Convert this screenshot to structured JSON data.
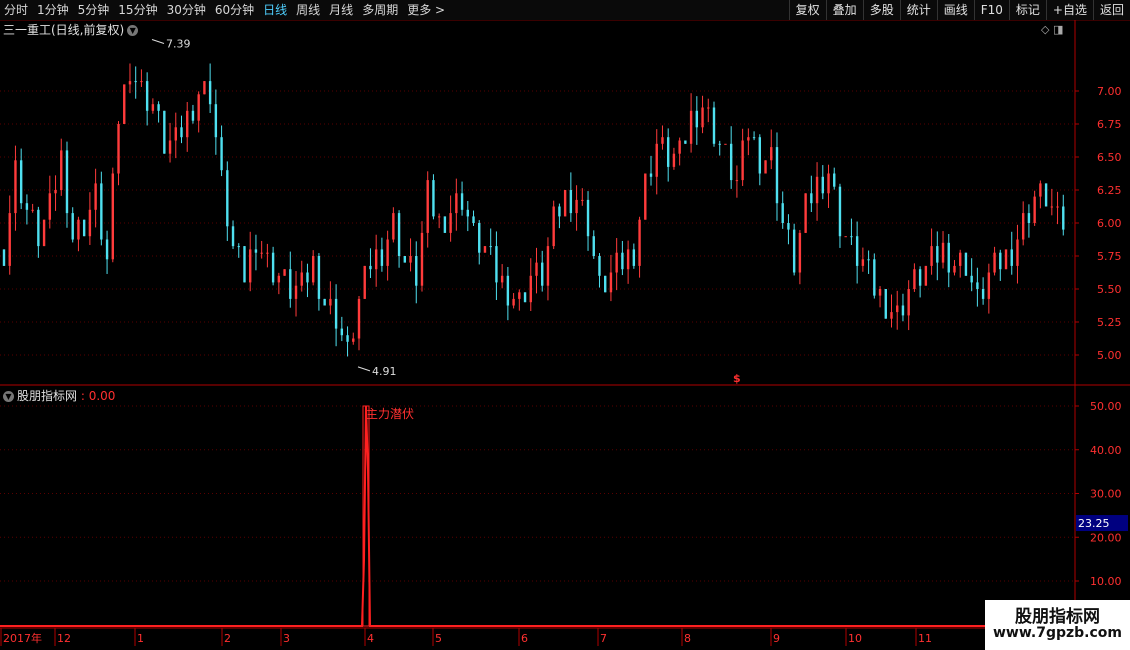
{
  "toolbar": {
    "periods": [
      "分时",
      "1分钟",
      "5分钟",
      "15分钟",
      "30分钟",
      "60分钟",
      "日线",
      "周线",
      "月线",
      "多周期",
      "更多 >"
    ],
    "active_period": "日线",
    "right_buttons": [
      "复权",
      "叠加",
      "多股",
      "统计",
      "画线",
      "F10",
      "标记",
      "+自选",
      "返回"
    ]
  },
  "main_chart": {
    "title": "三一重工(日线,前复权)",
    "icons": [
      "diamond-icon",
      "window-icon"
    ]
  },
  "indicator": {
    "name": "股朋指标网",
    "value_sep": " : ",
    "value": "0.00",
    "signal_label": "主力潜伏",
    "current_marker": "23.25"
  },
  "watermark": {
    "line1": "股朋指标网",
    "line2": "www.7gpzb.com"
  },
  "colors": {
    "up": "#ff3b3b",
    "down": "#4fe0f0",
    "axis": "#b00000",
    "grid": "#5a0000",
    "text_red": "#ff3030"
  },
  "chart_data": {
    "type": "candlestick",
    "price_axis": {
      "ticks": [
        "7.00",
        "6.75",
        "6.50",
        "6.25",
        "6.00",
        "5.75",
        "5.50",
        "5.25",
        "5.00"
      ]
    },
    "price_annotations": [
      {
        "label": "7.39",
        "value": 7.39
      },
      {
        "label": "4.91",
        "value": 4.91
      }
    ],
    "signal_mark": "$",
    "indicator_axis": {
      "ticks": [
        "50.00",
        "40.00",
        "30.00",
        "20.00",
        "10.00"
      ]
    },
    "time_axis": [
      "2017年",
      "12",
      "1",
      "2",
      "3",
      "4",
      "5",
      "6",
      "7",
      "8",
      "9",
      "10",
      "11"
    ],
    "candles_seed": [
      5.8,
      6.4,
      6.1,
      5.9,
      6.1,
      6.5,
      5.9,
      6.0,
      6.2,
      5.7,
      6.8,
      7.2,
      7.0,
      6.9,
      6.6,
      6.6,
      6.8,
      7.0,
      7.0,
      6.3,
      5.8,
      5.6,
      5.9,
      5.7,
      5.6,
      5.5,
      5.5,
      5.7,
      5.4,
      5.3,
      5.0,
      5.4,
      5.7,
      5.8,
      6.0,
      5.7,
      5.6,
      6.2,
      6.0,
      6.1,
      6.2,
      5.9,
      5.8,
      5.6,
      5.5,
      5.4,
      5.6,
      5.6,
      6.0,
      6.2,
      6.2,
      6.0,
      5.5,
      5.6,
      5.7,
      5.8,
      6.3,
      6.6,
      6.5,
      6.5,
      6.8,
      6.9,
      6.7,
      6.5,
      6.3,
      6.7,
      6.5,
      6.5,
      6.0,
      5.7,
      6.1,
      6.3,
      6.4,
      6.0,
      5.8,
      5.7,
      5.5,
      5.4,
      5.3,
      5.5,
      5.6,
      5.7,
      5.8,
      5.7,
      5.7,
      5.4,
      5.6,
      5.7,
      5.8,
      6.0,
      6.2,
      6.2,
      6.0
    ],
    "signal_spike": {
      "peak": 50
    }
  }
}
